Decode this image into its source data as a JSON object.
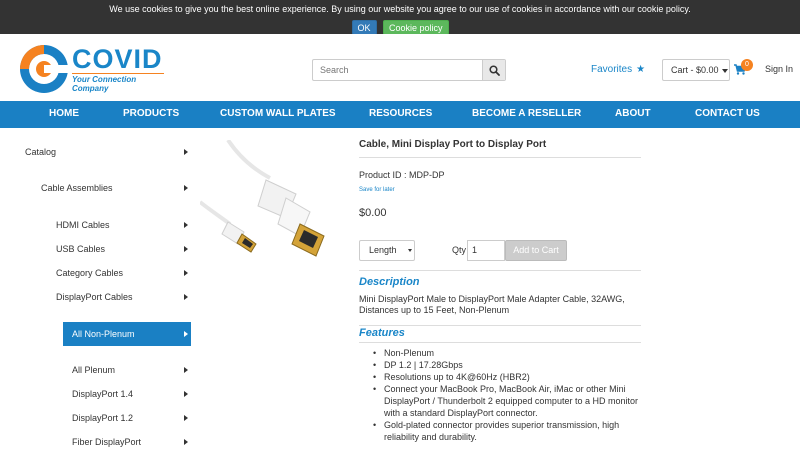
{
  "cookie": {
    "message": "We use cookies to give you the best online experience. By using our website you agree to our use of cookies in accordance with our cookie policy.",
    "ok_label": "OK",
    "policy_label": "Cookie policy"
  },
  "header": {
    "logo_text": "COVID",
    "logo_tagline": "Your Connection Company",
    "search_placeholder": "Search",
    "favorites_label": "Favorites",
    "cart_label": "Cart - $0.00",
    "cart_count": "0",
    "signin_label": "Sign In"
  },
  "nav": {
    "items": [
      "HOME",
      "PRODUCTS",
      "CUSTOM WALL PLATES",
      "RESOURCES",
      "BECOME A RESELLER",
      "ABOUT",
      "CONTACT US"
    ]
  },
  "sidebar": {
    "items": [
      {
        "label": "Catalog"
      },
      {
        "label": "Cable Assemblies"
      },
      {
        "label": "HDMI Cables"
      },
      {
        "label": "USB Cables"
      },
      {
        "label": "Category Cables"
      },
      {
        "label": "DisplayPort Cables"
      },
      {
        "label": "All Non-Plenum"
      },
      {
        "label": "All Plenum"
      },
      {
        "label": "DisplayPort 1.4"
      },
      {
        "label": "DisplayPort 1.2"
      },
      {
        "label": "Fiber DisplayPort"
      }
    ]
  },
  "product": {
    "title": "Cable, Mini Display Port to Display Port",
    "product_id": "Product ID : MDP-DP",
    "save_label": "Save for later",
    "price": "$0.00",
    "length_label": "Length",
    "qty_label": "Qty",
    "qty_value": "1",
    "add_to_cart_label": "Add to Cart",
    "description_heading": "Description",
    "description": "Mini DisplayPort Male to DisplayPort Male Adapter Cable, 32AWG, Distances up to 15 Feet, Non-Plenum",
    "features_heading": "Features",
    "features": [
      "Non-Plenum",
      "DP 1.2  |  17.28Gbps",
      "Resolutions up to 4K@60Hz (HBR2)",
      "Connect your MacBook Pro, MacBook Air, iMac or other Mini DisplayPort / Thunderbolt 2 equipped computer to a HD monitor with a standard DisplayPort connector.",
      "Gold-plated connector provides superior transmission, high reliability and durability."
    ]
  },
  "colors": {
    "brand_blue": "#1a80c4",
    "accent_orange": "#f58220",
    "cookie_bg": "#333333",
    "ok_button": "#337ab7",
    "policy_button": "#5cb85c"
  }
}
